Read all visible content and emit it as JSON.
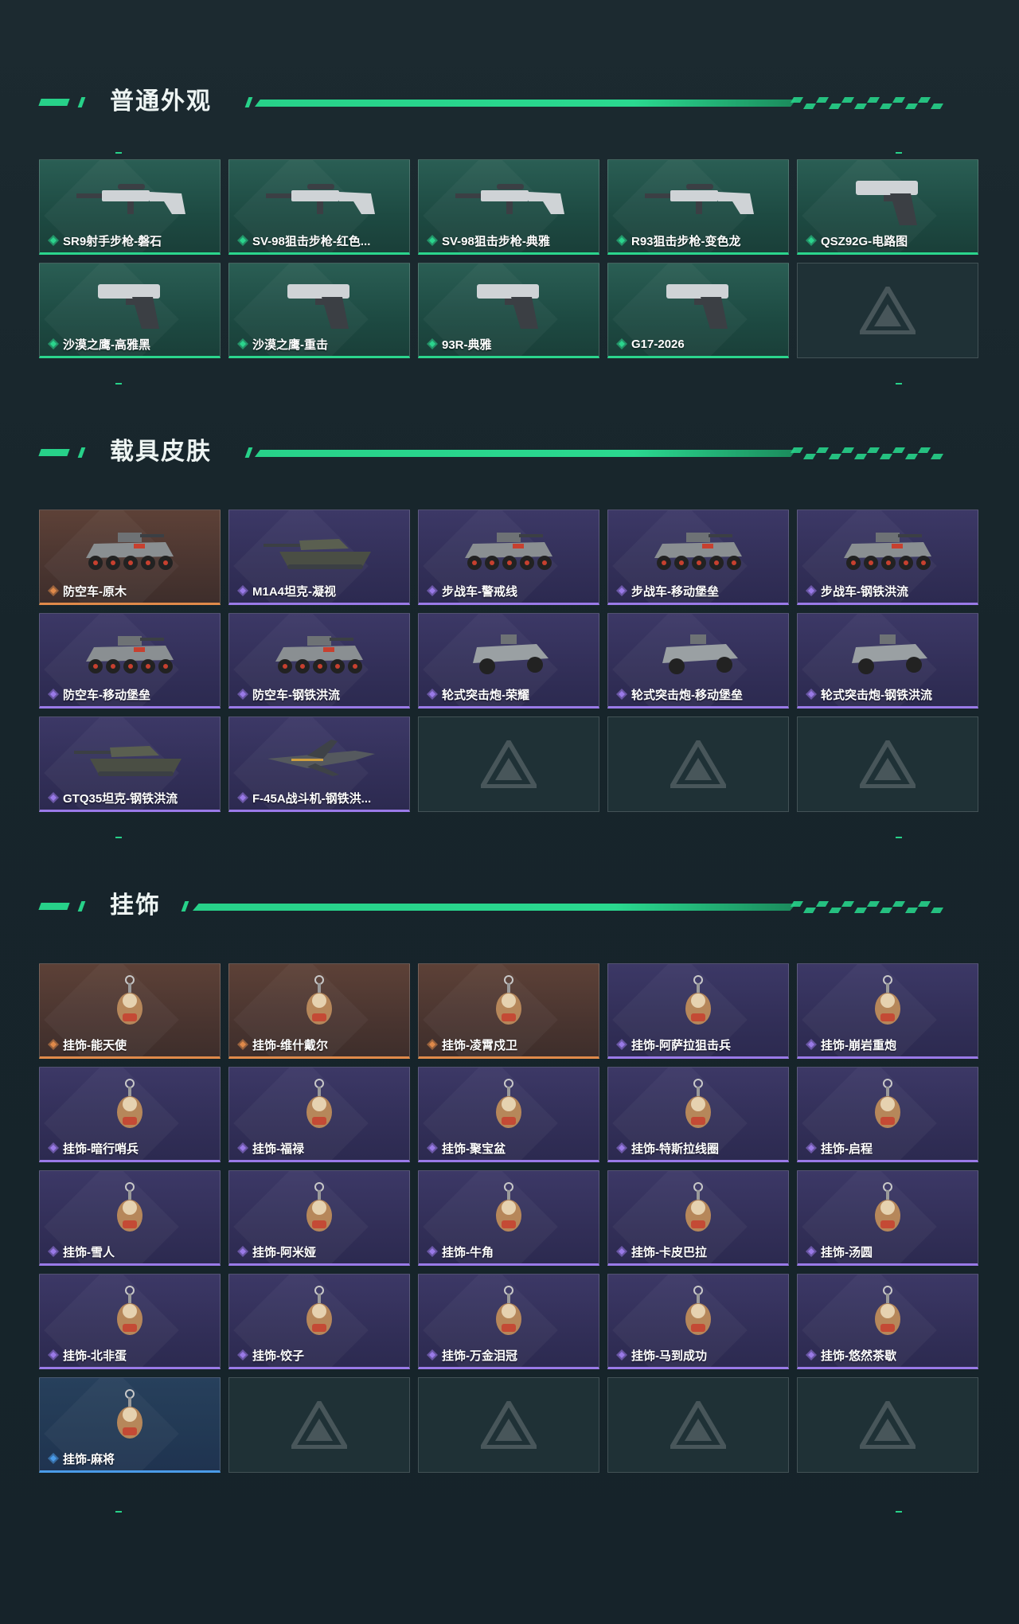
{
  "colors": {
    "accent": "#27d189",
    "rarity_green": "#2bd58d",
    "rarity_purple": "#9a7ae8",
    "rarity_orange": "#e08a4a",
    "rarity_blue": "#4a9be8"
  },
  "sections": [
    {
      "title": "普通外观",
      "items": [
        {
          "label": "SR9射手步枪-磐石",
          "rarity": "green",
          "icon": "rifle-icon"
        },
        {
          "label": "SV-98狙击步枪-红色...",
          "rarity": "green",
          "icon": "sniper-rifle-icon"
        },
        {
          "label": "SV-98狙击步枪-典雅",
          "rarity": "green",
          "icon": "sniper-rifle-icon"
        },
        {
          "label": "R93狙击步枪-变色龙",
          "rarity": "green",
          "icon": "sniper-rifle-icon"
        },
        {
          "label": "QSZ92G-电路图",
          "rarity": "green",
          "icon": "pistol-icon"
        },
        {
          "label": "沙漠之鹰-高雅黑",
          "rarity": "green",
          "icon": "pistol-icon"
        },
        {
          "label": "沙漠之鹰-重击",
          "rarity": "green",
          "icon": "pistol-icon"
        },
        {
          "label": "93R-典雅",
          "rarity": "green",
          "icon": "pistol-icon"
        },
        {
          "label": "G17-2026",
          "rarity": "green",
          "icon": "pistol-icon"
        },
        {
          "label": "",
          "rarity": "empty",
          "icon": "placeholder-logo-icon"
        }
      ]
    },
    {
      "title": "载具皮肤",
      "items": [
        {
          "label": "防空车-原木",
          "rarity": "orange",
          "icon": "armored-vehicle-icon"
        },
        {
          "label": "M1A4坦克-凝视",
          "rarity": "purple",
          "icon": "tank-icon"
        },
        {
          "label": "步战车-警戒线",
          "rarity": "purple",
          "icon": "armored-vehicle-icon"
        },
        {
          "label": "步战车-移动堡垒",
          "rarity": "purple",
          "icon": "armored-vehicle-icon"
        },
        {
          "label": "步战车-钢铁洪流",
          "rarity": "purple",
          "icon": "armored-vehicle-icon"
        },
        {
          "label": "防空车-移动堡垒",
          "rarity": "purple",
          "icon": "armored-vehicle-icon"
        },
        {
          "label": "防空车-钢铁洪流",
          "rarity": "purple",
          "icon": "armored-vehicle-icon"
        },
        {
          "label": "轮式突击炮-荣耀",
          "rarity": "purple",
          "icon": "buggy-icon"
        },
        {
          "label": "轮式突击炮-移动堡垒",
          "rarity": "purple",
          "icon": "buggy-icon"
        },
        {
          "label": "轮式突击炮-钢铁洪流",
          "rarity": "purple",
          "icon": "buggy-icon"
        },
        {
          "label": "GTQ35坦克-钢铁洪流",
          "rarity": "purple",
          "icon": "tank-icon"
        },
        {
          "label": "F-45A战斗机-钢铁洪...",
          "rarity": "purple",
          "icon": "jet-icon"
        },
        {
          "label": "",
          "rarity": "empty",
          "icon": "placeholder-logo-icon"
        },
        {
          "label": "",
          "rarity": "empty",
          "icon": "placeholder-logo-icon"
        },
        {
          "label": "",
          "rarity": "empty",
          "icon": "placeholder-logo-icon"
        }
      ]
    },
    {
      "title": "挂饰",
      "items": [
        {
          "label": "挂饰-能天使",
          "rarity": "orange",
          "icon": "charm-icon"
        },
        {
          "label": "挂饰-维什戴尔",
          "rarity": "orange",
          "icon": "charm-icon"
        },
        {
          "label": "挂饰-凌霄戍卫",
          "rarity": "orange",
          "icon": "charm-icon"
        },
        {
          "label": "挂饰-阿萨拉狙击兵",
          "rarity": "purple",
          "icon": "charm-icon"
        },
        {
          "label": "挂饰-崩岩重炮",
          "rarity": "purple",
          "icon": "charm-icon"
        },
        {
          "label": "挂饰-暗行哨兵",
          "rarity": "purple",
          "icon": "charm-icon"
        },
        {
          "label": "挂饰-福禄",
          "rarity": "purple",
          "icon": "charm-icon"
        },
        {
          "label": "挂饰-聚宝盆",
          "rarity": "purple",
          "icon": "charm-icon"
        },
        {
          "label": "挂饰-特斯拉线圈",
          "rarity": "purple",
          "icon": "charm-icon"
        },
        {
          "label": "挂饰-启程",
          "rarity": "purple",
          "icon": "charm-icon"
        },
        {
          "label": "挂饰-雪人",
          "rarity": "purple",
          "icon": "charm-icon"
        },
        {
          "label": "挂饰-阿米娅",
          "rarity": "purple",
          "icon": "charm-icon"
        },
        {
          "label": "挂饰-牛角",
          "rarity": "purple",
          "icon": "charm-icon"
        },
        {
          "label": "挂饰-卡皮巴拉",
          "rarity": "purple",
          "icon": "charm-icon"
        },
        {
          "label": "挂饰-汤圆",
          "rarity": "purple",
          "icon": "charm-icon"
        },
        {
          "label": "挂饰-北非蛋",
          "rarity": "purple",
          "icon": "charm-icon"
        },
        {
          "label": "挂饰-饺子",
          "rarity": "purple",
          "icon": "charm-icon"
        },
        {
          "label": "挂饰-万金泪冠",
          "rarity": "purple",
          "icon": "charm-icon"
        },
        {
          "label": "挂饰-马到成功",
          "rarity": "purple",
          "icon": "charm-icon"
        },
        {
          "label": "挂饰-悠然茶歇",
          "rarity": "purple",
          "icon": "charm-icon"
        },
        {
          "label": "挂饰-麻将",
          "rarity": "blue",
          "icon": "charm-icon"
        },
        {
          "label": "",
          "rarity": "empty",
          "icon": "placeholder-logo-icon"
        },
        {
          "label": "",
          "rarity": "empty",
          "icon": "placeholder-logo-icon"
        },
        {
          "label": "",
          "rarity": "empty",
          "icon": "placeholder-logo-icon"
        },
        {
          "label": "",
          "rarity": "empty",
          "icon": "placeholder-logo-icon"
        }
      ]
    }
  ]
}
